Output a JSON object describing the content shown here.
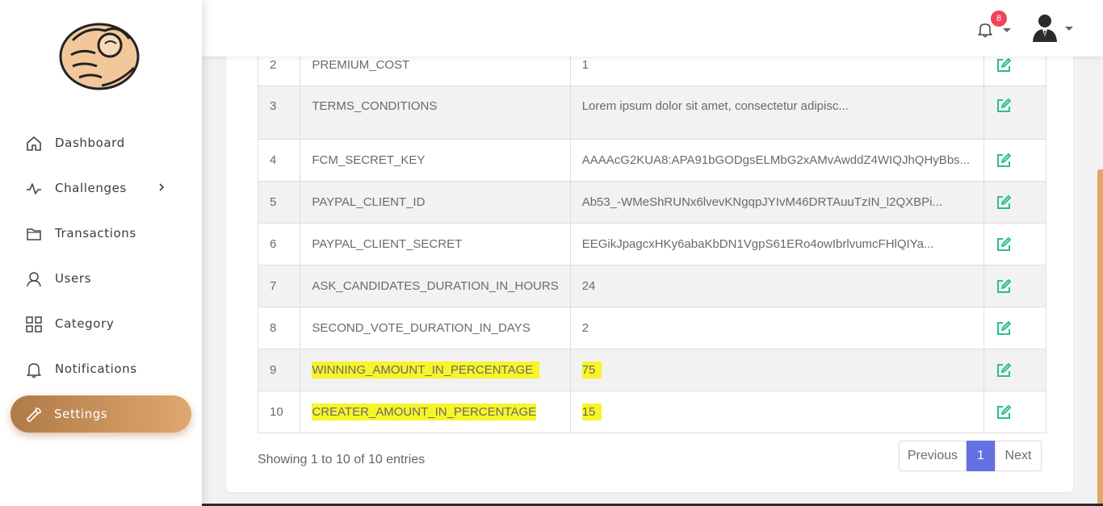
{
  "sidebar": {
    "items": [
      {
        "label": "Dashboard",
        "icon": "home-icon"
      },
      {
        "label": "Challenges",
        "icon": "activity-icon"
      },
      {
        "label": "Transactions",
        "icon": "folder-icon"
      },
      {
        "label": "Users",
        "icon": "user-icon"
      },
      {
        "label": "Category",
        "icon": "grid-icon"
      },
      {
        "label": "Notifications",
        "icon": "bell-icon"
      },
      {
        "label": "Settings",
        "icon": "wrench-icon"
      }
    ],
    "active": "Settings"
  },
  "header": {
    "notification_count": "8"
  },
  "table": {
    "rows": [
      {
        "num": "2",
        "key": "PREMIUM_COST",
        "value": "1"
      },
      {
        "num": "3",
        "key": "TERMS_CONDITIONS",
        "value": "Lorem ipsum dolor sit amet, consectetur adipisc..."
      },
      {
        "num": "4",
        "key": "FCM_SECRET_KEY",
        "value": "AAAAcG2KUA8:APA91bGODgsELMbG2xAMvAwddZ4WIQJhQHyBbs..."
      },
      {
        "num": "5",
        "key": "PAYPAL_CLIENT_ID",
        "value": "Ab53_-WMeShRUNx6lvevKNgqpJYIvM46DRTAuuTzIN_l2QXBPi..."
      },
      {
        "num": "6",
        "key": "PAYPAL_CLIENT_SECRET",
        "value": "EEGikJpagcxHKy6abaKbDN1VgpS61ERo4owIbrlvumcFHlQIYa..."
      },
      {
        "num": "7",
        "key": "ASK_CANDIDATES_DURATION_IN_HOURS",
        "value": "24"
      },
      {
        "num": "8",
        "key": "SECOND_VOTE_DURATION_IN_DAYS",
        "value": "2"
      },
      {
        "num": "9",
        "key": "WINNING_AMOUNT_IN_PERCENTAGE",
        "value": "75"
      },
      {
        "num": "10",
        "key": "CREATER_AMOUNT_IN_PERCENTAGE",
        "value": "15"
      }
    ]
  },
  "footer": {
    "showing": "Showing 1 to 10 of 10 entries",
    "prev": "Previous",
    "page": "1",
    "next": "Next"
  },
  "colors": {
    "accent": "#d39a5f",
    "edit_icon": "#2bbf8e",
    "pager_active": "#6571e2",
    "highlight": "#f7f42a",
    "badge": "#f2445a"
  }
}
